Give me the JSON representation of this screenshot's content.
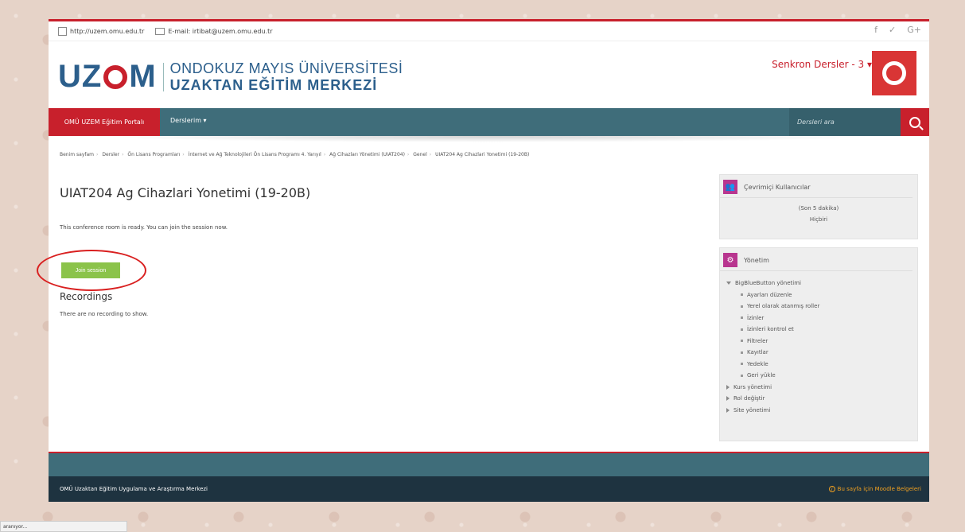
{
  "topbar": {
    "url_text": "http://uzem.omu.edu.tr",
    "email_text": "E-mail: irtibat@uzem.omu.edu.tr",
    "social": [
      "f",
      "✓",
      "G+"
    ]
  },
  "header": {
    "logo_mark_left": "UZ",
    "logo_mark_right": "M",
    "logo_line1": "ONDOKUZ MAYIS ÜNİVERSİTESİ",
    "logo_line2": "UZAKTAN EĞİTİM MERKEZİ",
    "user_name": "Senkron Dersler - 3 ▾"
  },
  "nav": {
    "home_label": "OMÜ UZEM Eğitim Portalı",
    "courses_label": "Derslerim ▾",
    "search_placeholder": "Dersleri ara"
  },
  "breadcrumb": [
    "Benim sayfam",
    "Dersler",
    "Ön Lisans Programları",
    "İnternet ve Ağ Teknolojileri Ön Lisans Programı 4. Yarıyıl",
    "Ağ Cihazları Yönetimi (UIAT204)",
    "Genel",
    "UIAT204 Ag Cihazlari Yonetimi (19-20B)"
  ],
  "main": {
    "title": "UIAT204 Ag Cihazlari Yonetimi (19-20B)",
    "info": "This conference room is ready. You can join the session now.",
    "join_label": "Join session",
    "recordings_title": "Recordings",
    "recordings_empty": "There are no recording to show."
  },
  "online_block": {
    "title": "Çevrimiçi Kullanıcılar",
    "subtitle": "(Son 5 dakika)",
    "value": "Hiçbiri"
  },
  "admin_block": {
    "title": "Yönetim",
    "bbb_label": "BigBlueButton yönetimi",
    "bbb_items": [
      "Ayarları düzenle",
      "Yerel olarak atanmış roller",
      "İzinler",
      "İzinleri kontrol et",
      "Filtreler",
      "Kayıtlar",
      "Yedekle",
      "Geri yükle"
    ],
    "other_items": [
      "Kurs yönetimi",
      "Rol değiştir",
      "Site yönetimi"
    ]
  },
  "footer": {
    "left": "OMÜ Uzaktan Eğitim Uygulama ve Araştırma Merkezi",
    "right": "Bu sayfa için Moodle Belgeleri"
  },
  "status_bar": "aranıyor...",
  "colors": {
    "brand_red": "#c8202c",
    "nav_teal": "#3f6d7a",
    "join_green": "#8bc34a",
    "block_icon": "#b8358f"
  }
}
